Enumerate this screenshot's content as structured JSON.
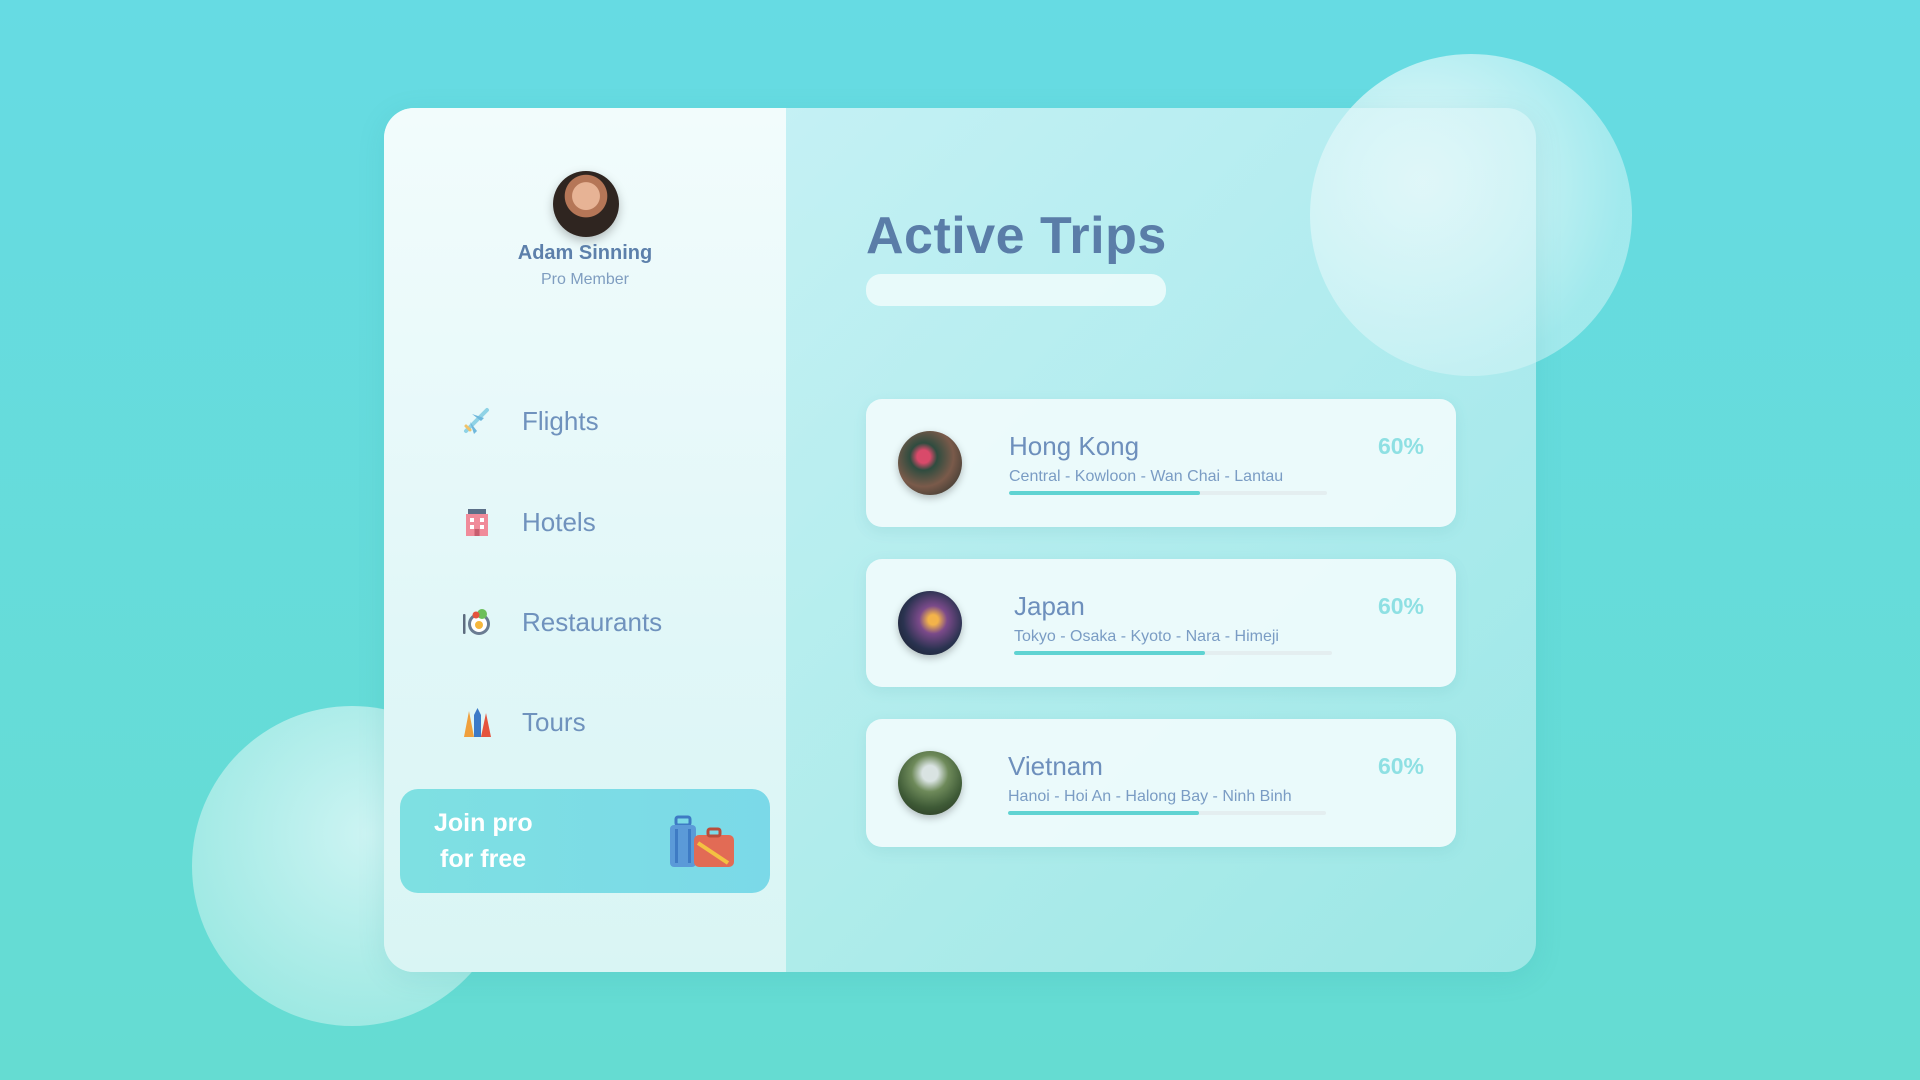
{
  "profile": {
    "name": "Adam Sinning",
    "role": "Pro Member"
  },
  "nav": [
    {
      "label": "Flights",
      "icon": "airplane-icon"
    },
    {
      "label": "Hotels",
      "icon": "hotel-icon"
    },
    {
      "label": "Restaurants",
      "icon": "food-plate-icon"
    },
    {
      "label": "Tours",
      "icon": "landmarks-icon"
    }
  ],
  "promo": {
    "line1": "Join pro",
    "line2": "for free",
    "icon": "luggage-icon"
  },
  "main": {
    "title": "Active Trips",
    "search_placeholder": ""
  },
  "trips": [
    {
      "name": "Hong Kong",
      "route": "Central - Kowloon - Wan Chai - Lantau",
      "percent": "60%",
      "progress": 0.6
    },
    {
      "name": "Japan",
      "route": "Tokyo - Osaka - Kyoto - Nara - Himeji",
      "percent": "60%",
      "progress": 0.6
    },
    {
      "name": "Vietnam",
      "route": "Hanoi - Hoi An - Halong Bay - Ninh Binh",
      "percent": "60%",
      "progress": 0.6
    }
  ],
  "colors": {
    "accent": "#5fd3d2",
    "text_primary": "#5a7da8",
    "percent": "#8ee0e3",
    "promo_bg": "#7ee0e2"
  }
}
